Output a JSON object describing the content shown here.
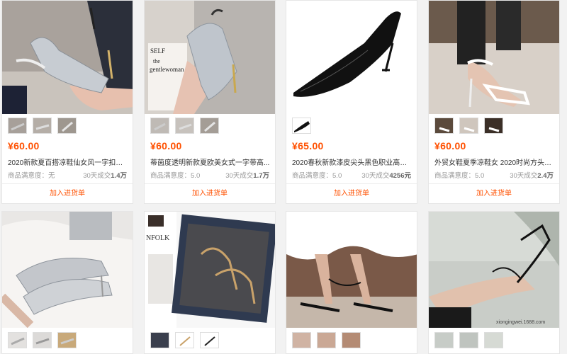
{
  "products": [
    {
      "price": "¥60.00",
      "title": "2020新款夏百搭凉鞋仙女风一字扣带...",
      "rating_label": "商品满意度：",
      "rating_value": "无",
      "sales_label": "30天成交",
      "sales_value": "1.4万",
      "button": "加入进货单"
    },
    {
      "price": "¥60.00",
      "title": "蒂茵度透明新款夏欧美女式一字带高...",
      "rating_label": "商品满意度：",
      "rating_value": "5.0",
      "sales_label": "30天成交",
      "sales_value": "1.7万",
      "button": "加入进货单"
    },
    {
      "price": "¥65.00",
      "title": "2020春秋新款漆皮尖头黑色职业高跟...",
      "rating_label": "商品满意度：",
      "rating_value": "5.0",
      "sales_label": "30天成交",
      "sales_value": "4256元",
      "button": "加入进货单"
    },
    {
      "price": "¥60.00",
      "title": "外贸女鞋夏季凉鞋女 2020时尚方头bv...",
      "rating_label": "商品满意度：",
      "rating_value": "5.0",
      "sales_label": "30天成交",
      "sales_value": "2.4万",
      "button": "加入进货单"
    }
  ],
  "image_text": {
    "magazine_line1": "SELF",
    "magazine_line2": "the",
    "magazine_line3": "gentlewoman",
    "box_brand": "NFOLK",
    "watermark": "xiongingwei.1688.com"
  },
  "colors": {
    "price": "#ff5000",
    "button": "#ff5000"
  }
}
